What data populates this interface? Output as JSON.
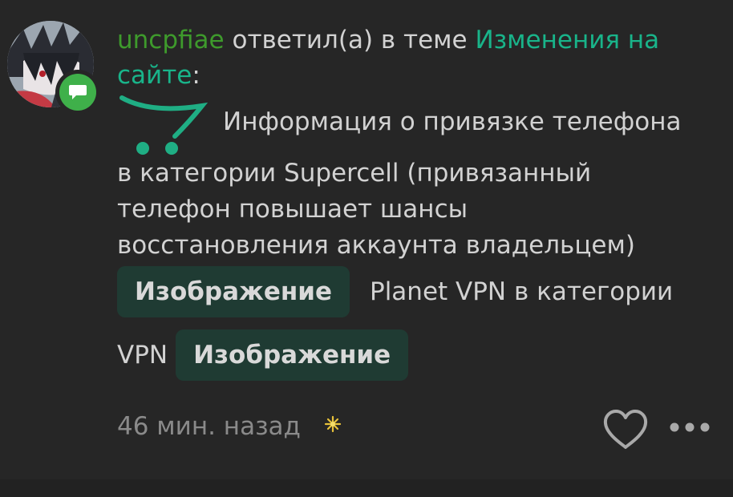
{
  "activity": {
    "username": "uncpfiae",
    "action": "ответил(а) в теме",
    "topic_line1": "Изменения на",
    "topic_line2": "сайте",
    "colon": ":"
  },
  "message": {
    "first_line": "Информация о привязке телефона",
    "lines": [
      "в категории Supercell (привязанный",
      "телефон повышает шансы",
      "восстановления аккаунта владельцем)"
    ],
    "chip1": "Изображение",
    "text_after_chip1": "Planet VPN в категории",
    "text_before_chip2": "VPN",
    "chip2": "Изображение"
  },
  "footer": {
    "time": "46 мин. назад",
    "icons": [
      "sparkle-icon",
      "heart-icon",
      "more-icon"
    ]
  },
  "colors": {
    "username": "#3e9a2c",
    "topic": "#19b48a",
    "background": "#262626",
    "chip_bg": "#1f3b33",
    "status": "#3fb04a"
  }
}
